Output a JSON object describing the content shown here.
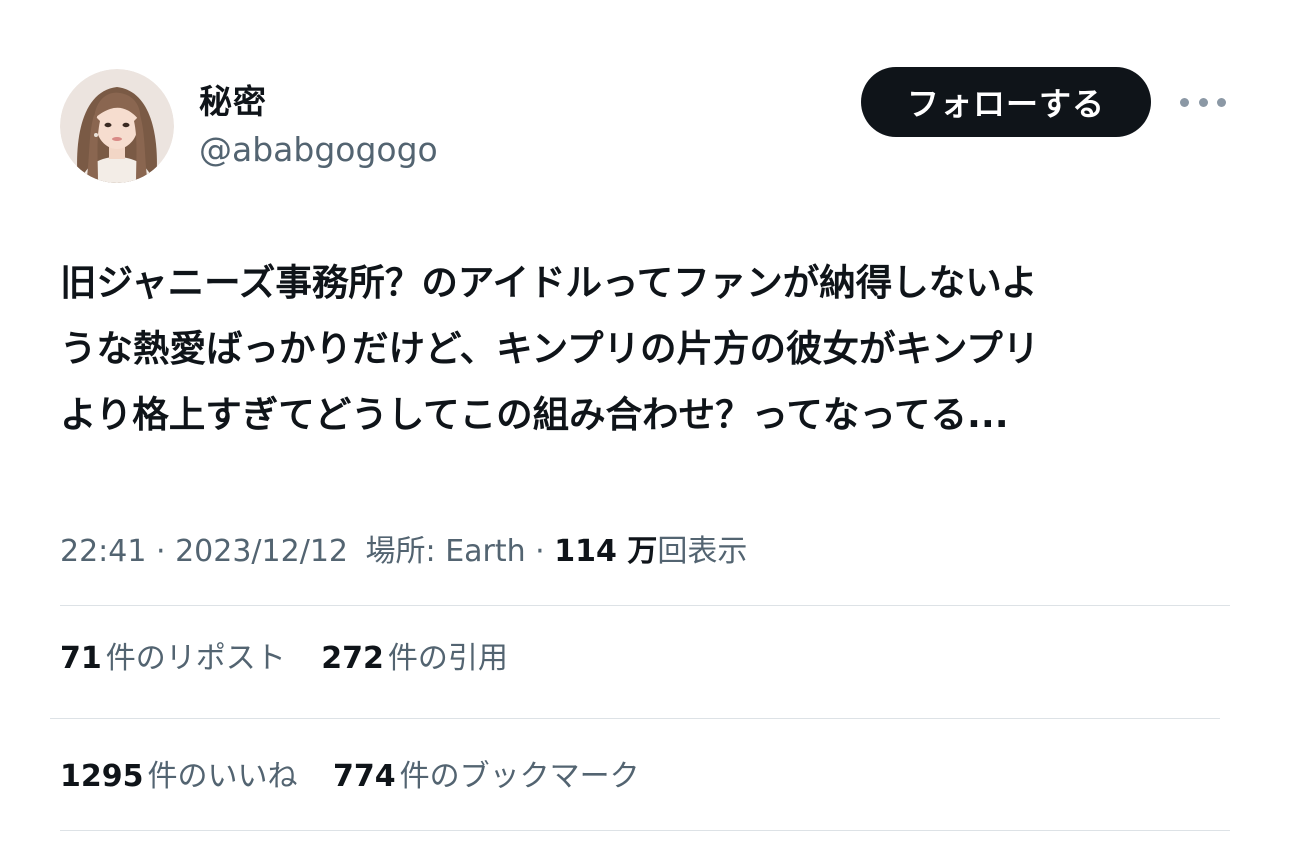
{
  "user": {
    "display_name": "秘密",
    "handle": "@ababgogogo",
    "avatar_icon": "user-avatar-photo"
  },
  "actions": {
    "follow_label": "フォローする",
    "more_icon": "more-horizontal-icon"
  },
  "tweet": {
    "lines": [
      "旧ジャニーズ事務所？のアイドルってファンが納得しないよ",
      "うな熱愛ばっかりだけど、キンプリの片方の彼女がキンプリ",
      "より格上すぎてどうしてこの組み合わせ？ってなってる..."
    ]
  },
  "meta": {
    "time": "22:41",
    "separator": " · ",
    "date": "2023/12/12",
    "location": "場所: Earth",
    "views_count": "114 万",
    "views_label": "回表示"
  },
  "stats": {
    "reposts_count": "71",
    "reposts_label": "件のリポスト",
    "quotes_count": "272",
    "quotes_label": "件の引用",
    "likes_count": "1295",
    "likes_label": "件のいいね",
    "bookmarks_count": "774",
    "bookmarks_label": "件のブックマーク"
  },
  "colors": {
    "text_primary": "#0f1419",
    "text_secondary": "#536471",
    "button_bg": "#0f1419",
    "divider": "#dde2e6"
  }
}
